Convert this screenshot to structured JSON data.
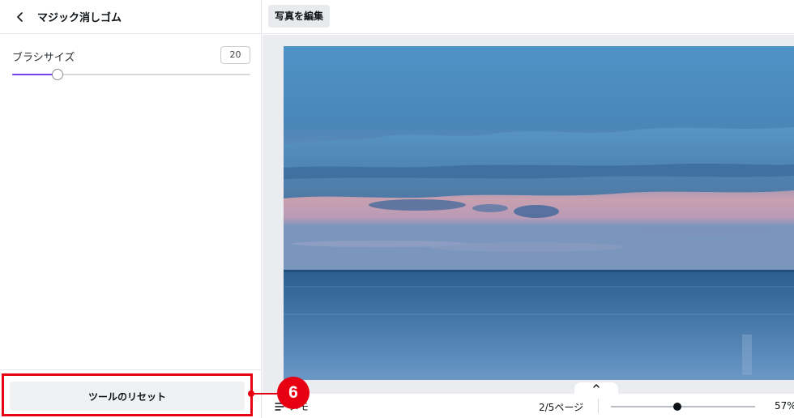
{
  "panel": {
    "title": "マジック消しゴム",
    "brush_size": {
      "label": "ブラシサイズ",
      "value": "20",
      "slider_fraction": 0.19
    },
    "reset_button_label": "ツールのリセット"
  },
  "toolbar": {
    "edit_photo_label": "写真を編集"
  },
  "annotation": {
    "callout_number": "6"
  },
  "bottom_bar": {
    "notes_label": "メモ",
    "page_indicator": "2/5ページ",
    "zoom_value": "57%",
    "zoom_fraction": 0.46
  },
  "colors": {
    "slider_accent": "#7b3ff2",
    "callout_red": "#e60012"
  },
  "icons": {
    "back": "chevron-left-icon",
    "collapse": "chevron-up-icon",
    "notes": "notes-icon"
  }
}
